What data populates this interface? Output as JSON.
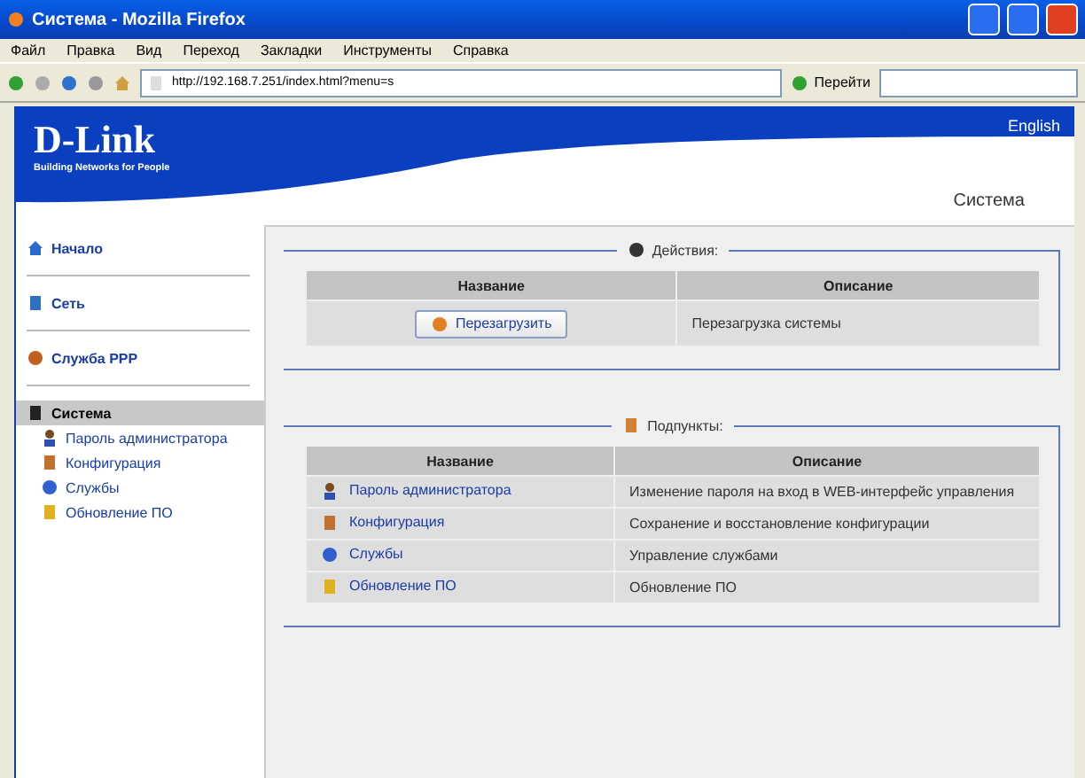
{
  "window": {
    "title": "Система - Mozilla Firefox"
  },
  "menu": [
    "Файл",
    "Правка",
    "Вид",
    "Переход",
    "Закладки",
    "Инструменты",
    "Справка"
  ],
  "address": {
    "value": "http://192.168.7.251/index.html?menu=s"
  },
  "go_button": "Перейти",
  "header": {
    "logo": "D-Link",
    "tagline": "Building Networks for People",
    "language": "English",
    "page_title": "Система"
  },
  "sidebar": {
    "items": [
      {
        "label": "Начало",
        "selected": false
      },
      {
        "label": "Сеть",
        "selected": false
      },
      {
        "label": "Служба PPP",
        "selected": false
      },
      {
        "label": "Система",
        "selected": true,
        "children": [
          {
            "label": "Пароль администратора"
          },
          {
            "label": "Конфигурация"
          },
          {
            "label": "Службы"
          },
          {
            "label": "Обновление ПО"
          }
        ]
      }
    ]
  },
  "actions": {
    "legend": "Действия:",
    "columns": [
      "Название",
      "Описание"
    ],
    "rows": [
      {
        "button": "Перезагрузить",
        "description": "Перезагрузка системы"
      }
    ]
  },
  "subitems": {
    "legend": "Подпункты:",
    "columns": [
      "Название",
      "Описание"
    ],
    "rows": [
      {
        "label": "Пароль администратора",
        "description": "Изменение пароля на вход в WEB-интерфейс управления"
      },
      {
        "label": "Конфигурация",
        "description": "Сохранение и восстановление конфигурации"
      },
      {
        "label": "Службы",
        "description": "Управление службами"
      },
      {
        "label": "Обновление ПО",
        "description": "Обновление ПО"
      }
    ]
  }
}
